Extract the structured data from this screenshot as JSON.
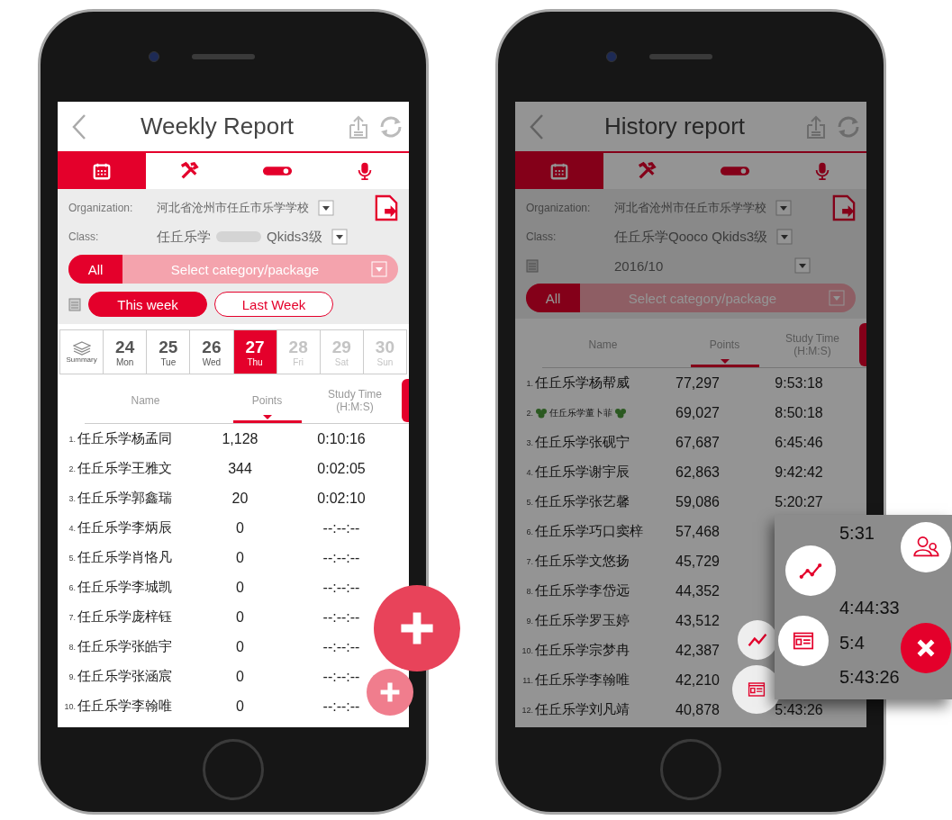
{
  "phones": [
    {
      "title": "Weekly Report",
      "dimmed": false,
      "tabs": [
        {
          "selected": true
        },
        {
          "selected": false
        },
        {
          "selected": false
        },
        {
          "selected": false
        }
      ],
      "organization_label": "Organization:",
      "organization": "河北省沧州市任丘市乐学学校",
      "class_label": "Class:",
      "class": [
        "任丘乐学",
        "Qkids3级"
      ],
      "category": {
        "all": "All",
        "placeholder": "Select category/package"
      },
      "week_buttons": [
        {
          "label": "This week",
          "selected": true
        },
        {
          "label": "Last Week",
          "selected": false
        }
      ],
      "days": [
        {
          "kind": "summary",
          "label": "Summary",
          "selected": false,
          "disabled": false
        },
        {
          "kind": "day",
          "day": "24",
          "weekday": "Mon",
          "selected": false,
          "disabled": false
        },
        {
          "kind": "day",
          "day": "25",
          "weekday": "Tue",
          "selected": false,
          "disabled": false
        },
        {
          "kind": "day",
          "day": "26",
          "weekday": "Wed",
          "selected": false,
          "disabled": false
        },
        {
          "kind": "day",
          "day": "27",
          "weekday": "Thu",
          "selected": true,
          "disabled": false
        },
        {
          "kind": "day",
          "day": "28",
          "weekday": "Fri",
          "selected": false,
          "disabled": true
        },
        {
          "kind": "day",
          "day": "29",
          "weekday": "Sat",
          "selected": false,
          "disabled": true
        },
        {
          "kind": "day",
          "day": "30",
          "weekday": "Sun",
          "selected": false,
          "disabled": true
        }
      ],
      "columns": [
        {
          "label": "Name",
          "sorted": false
        },
        {
          "label": "Points",
          "sorted": true
        },
        {
          "label": "Study Time\n(H:M:S)",
          "sorted": false
        }
      ],
      "rows": [
        {
          "rank": "1.",
          "name": "任丘乐学杨孟同",
          "points": "1,128",
          "time": "0:10:16"
        },
        {
          "rank": "2.",
          "name": "任丘乐学王雅文",
          "points": "344",
          "time": "0:02:05"
        },
        {
          "rank": "3.",
          "name": "任丘乐学郭鑫瑞",
          "points": "20",
          "time": "0:02:10"
        },
        {
          "rank": "4.",
          "name": "任丘乐学李炳辰",
          "points": "0",
          "time": "--:--:--"
        },
        {
          "rank": "5.",
          "name": "任丘乐学肖恪凡",
          "points": "0",
          "time": "--:--:--"
        },
        {
          "rank": "6.",
          "name": "任丘乐学李城凯",
          "points": "0",
          "time": "--:--:--"
        },
        {
          "rank": "7.",
          "name": "任丘乐学庞梓钰",
          "points": "0",
          "time": "--:--:--"
        },
        {
          "rank": "8.",
          "name": "任丘乐学张皓宇",
          "points": "0",
          "time": "--:--:--"
        },
        {
          "rank": "9.",
          "name": "任丘乐学张涵宸",
          "points": "0",
          "time": "--:--:--"
        },
        {
          "rank": "10.",
          "name": "任丘乐学李翰唯",
          "points": "0",
          "time": "--:--:--"
        }
      ]
    },
    {
      "title": "History report",
      "dimmed": true,
      "tabs": [
        {
          "selected": true
        },
        {
          "selected": false
        },
        {
          "selected": false
        },
        {
          "selected": false
        }
      ],
      "organization_label": "Organization:",
      "organization": "河北省沧州市任丘市乐学学校",
      "class_label": "Class:",
      "class": [
        "任丘乐学Qooco Qkids3级"
      ],
      "date": "2016/10",
      "category": {
        "all": "All",
        "placeholder": "Select category/package"
      },
      "columns": [
        {
          "label": "Name",
          "sorted": false
        },
        {
          "label": "Points",
          "sorted": true
        },
        {
          "label": "Study Time\n(H:M:S)",
          "sorted": false
        }
      ],
      "rows": [
        {
          "rank": "1.",
          "name": "任丘乐学杨帮威",
          "points": "77,297",
          "time": "9:53:18",
          "decorated": false
        },
        {
          "rank": "2.",
          "name": "任丘乐学董卜菲",
          "points": "69,027",
          "time": "8:50:18",
          "decorated": true
        },
        {
          "rank": "3.",
          "name": "任丘乐学张砚宁",
          "points": "67,687",
          "time": "6:45:46",
          "decorated": false
        },
        {
          "rank": "4.",
          "name": "任丘乐学谢宇辰",
          "points": "62,863",
          "time": "9:42:42",
          "decorated": false
        },
        {
          "rank": "5.",
          "name": "任丘乐学张艺馨",
          "points": "59,086",
          "time": "5:20:27",
          "decorated": false
        },
        {
          "rank": "6.",
          "name": "任丘乐学巧口窦梓",
          "points": "57,468",
          "decorated": false
        },
        {
          "rank": "7.",
          "name": "任丘乐学文悠扬",
          "points": "45,729",
          "decorated": false
        },
        {
          "rank": "8.",
          "name": "任丘乐学李岱远",
          "points": "44,352",
          "decorated": false
        },
        {
          "rank": "9.",
          "name": "任丘乐学罗玉婷",
          "points": "43,512",
          "decorated": false
        },
        {
          "rank": "10.",
          "name": "任丘乐学宗梦冉",
          "points": "42,387",
          "decorated": false
        },
        {
          "rank": "11.",
          "name": "任丘乐学李翰唯",
          "points": "42,210",
          "decorated": false
        },
        {
          "rank": "12.",
          "name": "任丘乐学刘凡靖",
          "points": "40,878",
          "time": "5:43:26",
          "decorated": false
        }
      ]
    }
  ],
  "zoom_panel": {
    "times": [
      "5:31",
      "4:44:33",
      "5:4",
      "5:43:26"
    ]
  }
}
